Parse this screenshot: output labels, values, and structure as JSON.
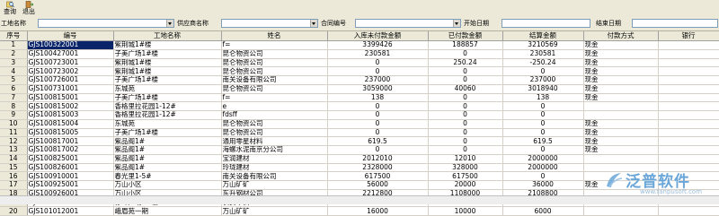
{
  "toolbar": {
    "query_label": "查询",
    "exit_label": "退出"
  },
  "filters": {
    "site_name_label": "工地名称",
    "supplier_label": "供应商名称",
    "contract_no_label": "合同编号",
    "start_date_label": "开始日期",
    "end_date_label": "结束日期",
    "site_name_value": "",
    "supplier_value": "",
    "contract_no_value": "",
    "start_date_value": "",
    "end_date_value": ""
  },
  "table": {
    "columns": [
      "序号",
      "编号",
      "工地名称",
      "姓名",
      "入库未付款金额",
      "已付款金额",
      "结算金额",
      "付款方式",
      "银行"
    ],
    "rows": [
      {
        "seq": "1",
        "code": "GJS100322001",
        "site": "紫荆城1#楼",
        "name": "f=",
        "unpaid": "3399426",
        "paid": "188857",
        "settle": "3210569",
        "method": "现金",
        "bank": ""
      },
      {
        "seq": "2",
        "code": "GJS100427001",
        "site": "子美广场1#楼",
        "name": "昆仑物资公司",
        "unpaid": "230581",
        "paid": "0",
        "settle": "230581",
        "method": "现金",
        "bank": ""
      },
      {
        "seq": "3",
        "code": "GJS100723001",
        "site": "紫荆城1#楼",
        "name": "昆仑物资公司",
        "unpaid": "0",
        "paid": "250.24",
        "settle": "-250.24",
        "method": "现金",
        "bank": ""
      },
      {
        "seq": "4",
        "code": "GJS100723002",
        "site": "紫荆城1#楼",
        "name": "昆仑物资公司",
        "unpaid": "0",
        "paid": "0",
        "settle": "0",
        "method": "现金",
        "bank": ""
      },
      {
        "seq": "5",
        "code": "GJS100726001",
        "site": "子美广场1#楼",
        "name": "南关设备有限公司",
        "unpaid": "237000",
        "paid": "0",
        "settle": "237000",
        "method": "现金",
        "bank": ""
      },
      {
        "seq": "6",
        "code": "GJS100731001",
        "site": "东城苑",
        "name": "昆仑物资公司",
        "unpaid": "3059000",
        "paid": "40060",
        "settle": "3018940",
        "method": "现金",
        "bank": ""
      },
      {
        "seq": "7",
        "code": "GJS100815001",
        "site": "子美广场1#楼",
        "name": "f=",
        "unpaid": "138",
        "paid": "0",
        "settle": "138",
        "method": "现金",
        "bank": ""
      },
      {
        "seq": "8",
        "code": "GJS100815002",
        "site": "香格里拉花园1-12#",
        "name": "e",
        "unpaid": "0",
        "paid": "0",
        "settle": "0",
        "method": "",
        "bank": ""
      },
      {
        "seq": "9",
        "code": "GJS100815003",
        "site": "香格里拉花园1-12#",
        "name": "fdsff",
        "unpaid": "0",
        "paid": "0",
        "settle": "0",
        "method": "",
        "bank": ""
      },
      {
        "seq": "10",
        "code": "GJS100815004",
        "site": "东城苑",
        "name": "昆仑物资公司",
        "unpaid": "0",
        "paid": "0",
        "settle": "0",
        "method": "现金",
        "bank": ""
      },
      {
        "seq": "11",
        "code": "GJS100815005",
        "site": "子美广场1#楼",
        "name": "昆仑物资公司",
        "unpaid": "0",
        "paid": "0",
        "settle": "0",
        "method": "现金",
        "bank": ""
      },
      {
        "seq": "12",
        "code": "GJS100817001",
        "site": "紫品阁1#",
        "name": "通用零星材料",
        "unpaid": "619.5",
        "paid": "0",
        "settle": "619.5",
        "method": "现金",
        "bank": ""
      },
      {
        "seq": "13",
        "code": "GJS100817002",
        "site": "紫品阁1#",
        "name": "海螺水泥南京分公司",
        "unpaid": "0",
        "paid": "0",
        "settle": "0",
        "method": "现金",
        "bank": ""
      },
      {
        "seq": "14",
        "code": "GJS100825001",
        "site": "紫品阁1#",
        "name": "宝润建材",
        "unpaid": "2012010",
        "paid": "12010",
        "settle": "2000000",
        "method": "",
        "bank": ""
      },
      {
        "seq": "15",
        "code": "GJS100826001",
        "site": "紫品阁1#",
        "name": "玲珑建材",
        "unpaid": "2328000",
        "paid": "328000",
        "settle": "2000000",
        "method": "",
        "bank": ""
      },
      {
        "seq": "16",
        "code": "GJS100910001",
        "site": "春光里1-5#",
        "name": "南关设备有限公司",
        "unpaid": "617500",
        "paid": "617500",
        "settle": "0",
        "method": "",
        "bank": ""
      },
      {
        "seq": "17",
        "code": "GJS100925001",
        "site": "万山小区",
        "name": "万山矿矿",
        "unpaid": "56000",
        "paid": "20000",
        "settle": "36000",
        "method": "现金",
        "bank": ""
      },
      {
        "seq": "18",
        "code": "GJS100926001",
        "site": "万山小区",
        "name": "东升钢材公司",
        "unpaid": "2212800",
        "paid": "1108000",
        "settle": "2108800",
        "method": "",
        "bank": ""
      },
      {
        "seq": "19",
        "code": "GJS100929001",
        "site": "赤峰广场1#楼",
        "name": "长安甲供",
        "unpaid": "215000",
        "paid": "0",
        "settle": "215000",
        "method": "",
        "bank": ""
      },
      {
        "seq": "20",
        "code": "GJS101012001",
        "site": "峨眉苑一期",
        "name": "万山矿矿",
        "unpaid": "16000",
        "paid": "10000",
        "settle": "6000",
        "method": "",
        "bank": ""
      }
    ]
  },
  "watermark": {
    "text": "泛普软件",
    "url": "www.fanpusoft.com",
    "color": "#6aa6d8"
  },
  "colors": {
    "selected_row_bg": "#0a246a",
    "chrome_bg": "#ece9d8"
  }
}
